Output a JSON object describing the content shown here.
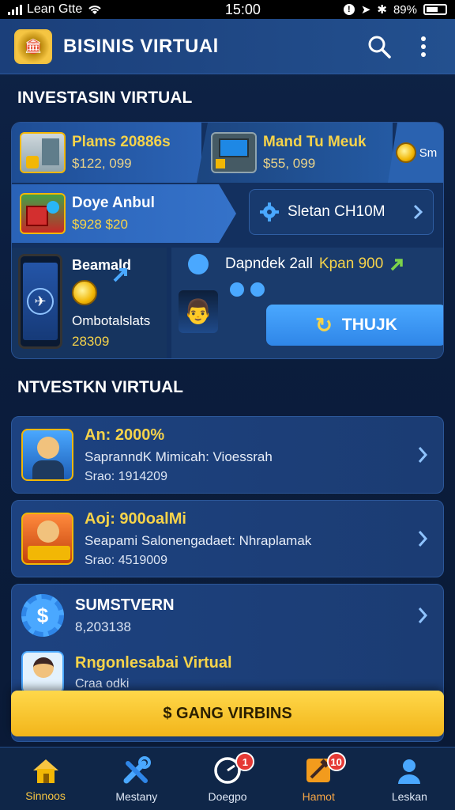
{
  "status_bar": {
    "carrier": "Lean Gtte",
    "time": "15:00",
    "battery": "89%"
  },
  "app_bar": {
    "title": "BISINIS VIRTUAl"
  },
  "section1": {
    "title": "INVESTASIN VIRTUAL",
    "card1": {
      "title": "Plams 20886s",
      "value": "$122, 099"
    },
    "card2": {
      "title": "Mand Tu Meuk",
      "value": "$55, 099"
    },
    "card3": {
      "label": "Sm"
    },
    "card4": {
      "title": "Doye Anbul",
      "value": "$928 $20"
    },
    "card5": {
      "label": "Sletan CH10M"
    },
    "card6": {
      "title": "Beamald",
      "subtitle": "Ombotalslats",
      "value": "28309"
    },
    "card7": {
      "title": "Dapndek 2all",
      "highlight": "Kpan 900",
      "button": "THUJK"
    }
  },
  "section2": {
    "title": "NTVESTKN VIRTUAL",
    "items": [
      {
        "title": "An: 2000%",
        "subtitle": "SapranndK Mimicah: Vioessrah",
        "value": "Srao: 1914209"
      },
      {
        "title": "Aoj: 900oalMi",
        "subtitle": "Seapami Salonengadaet: Nhraplamak",
        "value": "Srao: 4519009"
      },
      {
        "title": "SUMSTVERN",
        "value": "8,203138"
      },
      {
        "title": "Rngonlesabai Virtual",
        "value": "Craa odki"
      }
    ]
  },
  "cta": {
    "label": "$ GANG VIRBINS"
  },
  "bottom_nav": [
    {
      "label": "Sinnoos",
      "icon": "home-icon",
      "active": true
    },
    {
      "label": "Mestany",
      "icon": "tools-icon",
      "active": false
    },
    {
      "label": "Doegpo",
      "icon": "gauge-icon",
      "active": false,
      "badge": "1"
    },
    {
      "label": "Hamot",
      "icon": "hammer-icon",
      "active": false,
      "badge": "10"
    },
    {
      "label": "Leskan",
      "icon": "user-icon",
      "active": false
    }
  ],
  "colors": {
    "accent_yellow": "#f6d34a",
    "primary_blue": "#2f86e8",
    "background": "#0b1d3d"
  }
}
